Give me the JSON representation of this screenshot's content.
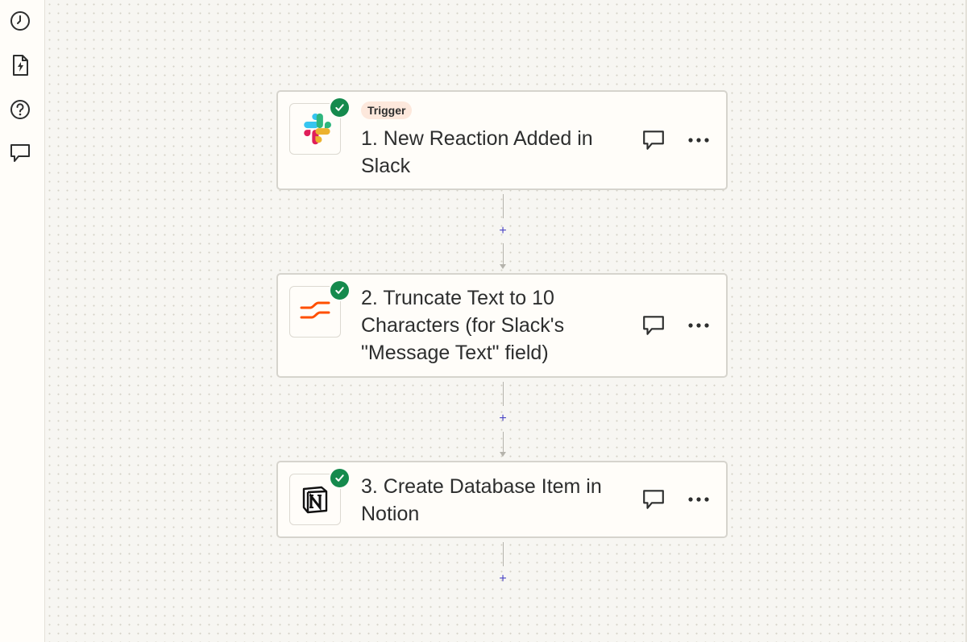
{
  "sidebar": {
    "icons": [
      "history-icon",
      "zap-file-icon",
      "help-icon",
      "comment-icon"
    ]
  },
  "steps": [
    {
      "app_icon": "slack-icon",
      "status_icon": "check-icon",
      "badge": "Trigger",
      "title": "1. New Reaction Added in Slack"
    },
    {
      "app_icon": "formatter-icon",
      "status_icon": "check-icon",
      "title": "2. Truncate Text to 10 Characters (for Slack's \"Message Text\" field)"
    },
    {
      "app_icon": "notion-icon",
      "status_icon": "check-icon",
      "title": "3. Create Database Item in Notion"
    }
  ],
  "connectors": {
    "add_label": "+"
  },
  "colors": {
    "success": "#158a4d",
    "accent": "#4b46c5",
    "trigger_badge_bg": "#fde8dc",
    "formatter": "#ff4f00"
  }
}
